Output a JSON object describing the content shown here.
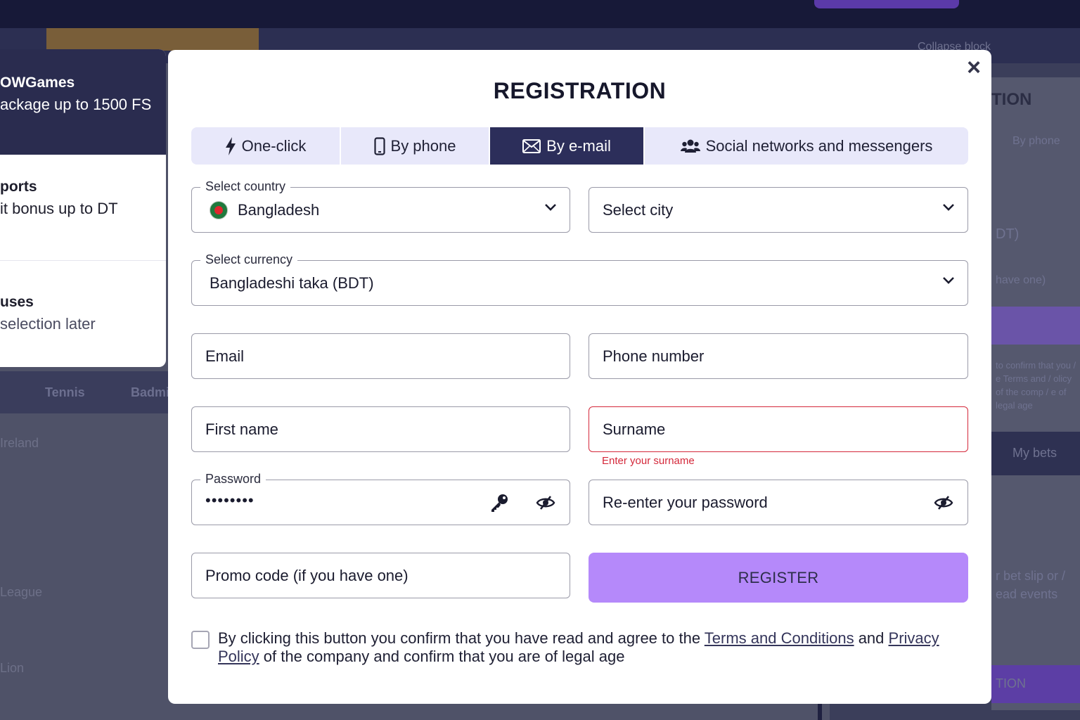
{
  "background": {
    "sports": [
      "Tennis",
      "Badminton"
    ],
    "list_items": [
      "Ireland",
      "League",
      "Lion"
    ],
    "right_panel": {
      "collapse_label": "Collapse block",
      "heading": "TION",
      "tab_phone": "By phone",
      "currency_partial": "DT)",
      "promo_partial": "have one)",
      "terms_partial": "to confirm that you / e Terms and / olicy of the comp / e of legal age",
      "my_bets": "My bets",
      "betslip_partial": "r bet slip or / ead events",
      "bottom_btn": "TION"
    }
  },
  "promo": {
    "games_title": "OWGames",
    "games_desc": "ackage up to 1500 FS",
    "sports_title": "ports",
    "sports_desc": "it bonus up to DT",
    "bonuses_title": "uses",
    "bonuses_desc": "selection later"
  },
  "modal": {
    "title": "REGISTRATION",
    "close_label": "×",
    "tabs": [
      {
        "label": "One-click",
        "icon": "lightning-icon"
      },
      {
        "label": "By phone",
        "icon": "phone-icon"
      },
      {
        "label": "By e-mail",
        "icon": "envelope-icon",
        "active": true
      },
      {
        "label": "Social networks and messengers",
        "icon": "users-icon"
      }
    ],
    "country": {
      "legend": "Select country",
      "value": "Bangladesh"
    },
    "city": {
      "placeholder": "Select city"
    },
    "currency": {
      "legend": "Select currency",
      "value": "Bangladeshi taka (BDT)"
    },
    "email": {
      "placeholder": "Email"
    },
    "phone": {
      "placeholder": "Phone number"
    },
    "first_name": {
      "placeholder": "First name"
    },
    "surname": {
      "placeholder": "Surname",
      "error": "Enter your surname"
    },
    "password": {
      "legend": "Password",
      "value": "••••••••"
    },
    "reenter": {
      "placeholder": "Re-enter your password"
    },
    "promo_code": {
      "placeholder": "Promo code (if you have one)"
    },
    "register_label": "REGISTER",
    "agree": {
      "text_before": "By clicking this button you confirm that you have read and agree to the ",
      "terms_link": "Terms and Conditions",
      "text_and": " and ",
      "privacy_link": "Privacy Policy",
      "text_after": " of the company and confirm that you are of legal age"
    }
  },
  "colors": {
    "accent_dark": "#2c2e5a",
    "register_purple": "#b589fa",
    "error_red": "#d4283a",
    "tab_bg": "#e8e8fa"
  }
}
